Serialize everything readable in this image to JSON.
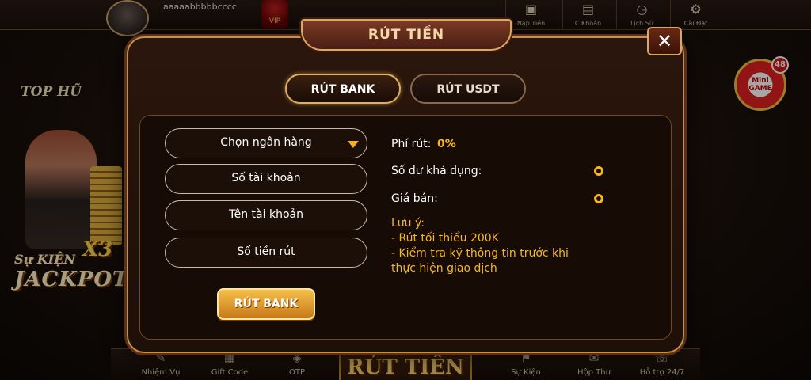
{
  "lobby": {
    "username": "aaaaabbbbbcccc",
    "vip_label": "VIP",
    "top_icons": [
      {
        "label": "Nạp Tiền",
        "icon": "wallet-icon"
      },
      {
        "label": "C.Khoản",
        "icon": "card-icon"
      },
      {
        "label": "Lịch Sử",
        "icon": "history-icon"
      },
      {
        "label": "Cài Đặt",
        "icon": "gear-icon"
      }
    ],
    "top_hu_label": "TOP HŨ",
    "event": {
      "line1": "Sự KIỆN",
      "multiplier": "X3",
      "line2": "JACKPOT"
    },
    "mini_game": {
      "line1": "Mini",
      "line2": "GAME",
      "badge": "48"
    },
    "bottom_items_left": [
      {
        "label": "Nhiệm Vụ",
        "icon": "mission-icon"
      },
      {
        "label": "Gift Code",
        "icon": "gift-icon"
      },
      {
        "label": "OTP",
        "icon": "otp-icon"
      }
    ],
    "bottom_center": "RÚT TIỀN",
    "bottom_items_right": [
      {
        "label": "Sự Kiện",
        "icon": "event-icon"
      },
      {
        "label": "Hộp Thư",
        "icon": "mail-icon"
      },
      {
        "label": "Hỗ trợ 24/7",
        "icon": "support-icon"
      }
    ]
  },
  "dialog": {
    "title": "RÚT TIỀN",
    "close_label": "✕",
    "tabs": [
      {
        "label": "RÚT BANK",
        "active": true
      },
      {
        "label": "RÚT USDT",
        "active": false
      }
    ],
    "form": {
      "bank_select": "Chọn ngân hàng",
      "account_number": "Số tài khoản",
      "account_name": "Tên tài khoản",
      "amount": "Số tiền rút",
      "submit_label": "RÚT BANK"
    },
    "info": {
      "fee_label": "Phí rút:",
      "fee_value": "0%",
      "balance_label": "Số dư khả dụng:",
      "price_label": "Giá bán:",
      "note_title": "Lưu ý:",
      "note_lines": [
        "- Rút tối thiểu 200K",
        "- Kiểm tra kỹ thông tin trước khi",
        "thực hiện giao dịch"
      ]
    }
  },
  "colors": {
    "accent_gold": "#f6b81e",
    "border_gold": "#d8a86a",
    "panel_dark": "#170b05"
  }
}
